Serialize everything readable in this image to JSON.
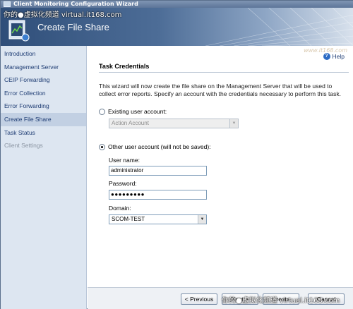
{
  "window": {
    "title": "Client Monitoring Configuration Wizard"
  },
  "watermarks": {
    "top": "你的●虚拟化频道 virtual.it168.com",
    "bottom": "你的●虚拟化频道 virtual.it168.com",
    "right": "www.it168.com"
  },
  "header": {
    "title": "Create File Share"
  },
  "nav": {
    "items": [
      {
        "label": "Introduction",
        "state": "normal"
      },
      {
        "label": "Management Server",
        "state": "normal"
      },
      {
        "label": "CEIP Forwarding",
        "state": "normal"
      },
      {
        "label": "Error Collection",
        "state": "normal"
      },
      {
        "label": "Error Forwarding",
        "state": "normal"
      },
      {
        "label": "Create File Share",
        "state": "active"
      },
      {
        "label": "Task Status",
        "state": "normal"
      },
      {
        "label": "Client Settings",
        "state": "disabled"
      }
    ]
  },
  "main": {
    "help_label": "Help",
    "section_title": "Task Credentials",
    "description": "This wizard will now create the file share on the Management Server that will be used to collect error reports. Specify an account with the credentials necessary to perform this task.",
    "existing_account": {
      "label": "Existing user account:",
      "selected": false,
      "dropdown_value": "Action Account"
    },
    "other_account": {
      "label": "Other user account (will not be saved):",
      "selected": true
    },
    "username": {
      "label": "User name:",
      "value": "administrator"
    },
    "password": {
      "label": "Password:",
      "value": "●●●●●●●●●"
    },
    "domain": {
      "label": "Domain:",
      "value": "SCOM-TEST"
    }
  },
  "buttons": {
    "previous": "< Previous",
    "next": "Next >",
    "create": "Create",
    "cancel": "Cancel"
  },
  "colors": {
    "header_dark": "#2f4e79",
    "nav_bg": "#dde6f1",
    "nav_text": "#1f3d74",
    "active_bg": "#c2d0e3"
  }
}
